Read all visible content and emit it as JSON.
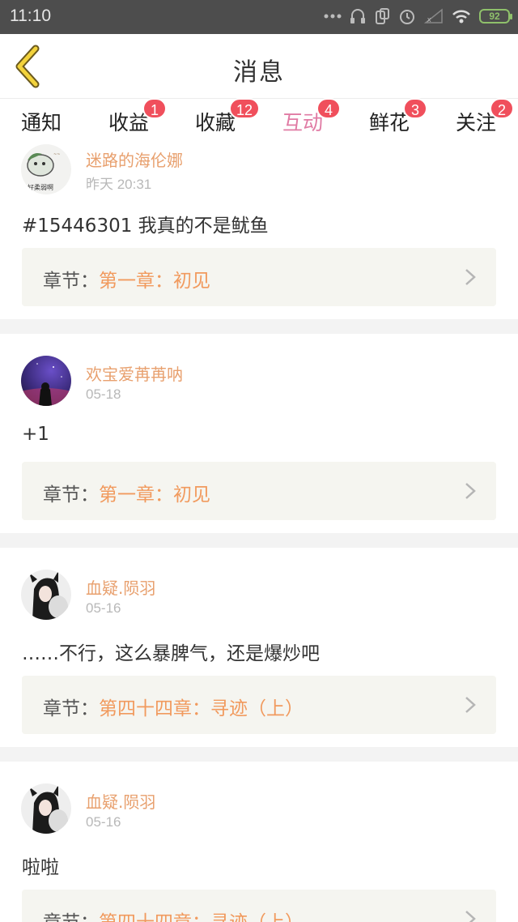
{
  "status_bar": {
    "time": "11:10",
    "battery": "92"
  },
  "nav": {
    "title": "消息"
  },
  "tabs": [
    {
      "label": "通知",
      "badge": ""
    },
    {
      "label": "收益",
      "badge": "1"
    },
    {
      "label": "收藏",
      "badge": "12"
    },
    {
      "label": "互动",
      "badge": "4"
    },
    {
      "label": "鲜花",
      "badge": "3"
    },
    {
      "label": "关注",
      "badge": "2"
    }
  ],
  "chapter_prefix": "章节：",
  "messages": [
    {
      "user": "迷路的海伦娜",
      "date": "昨天 20:31",
      "content": "#15446301 我真的不是鱿鱼",
      "chapter": "第一章：初见",
      "avatar_text": "好柔弱啊"
    },
    {
      "user": "欢宝爱苒苒呐",
      "date": "05-18",
      "content": "+1",
      "chapter": "第一章：初见"
    },
    {
      "user": "血疑.陨羽",
      "date": "05-16",
      "content": "……不行，这么暴脾气，还是爆炒吧",
      "chapter": "第四十四章：寻迹（上）"
    },
    {
      "user": "血疑.陨羽",
      "date": "05-16",
      "content": "啦啦",
      "chapter": "第四十四章：寻迹（上）"
    }
  ],
  "colors": {
    "accent": "#e07ba4",
    "username": "#e8a06e",
    "chapter": "#f19a5e",
    "badge": "#f04f5c"
  }
}
